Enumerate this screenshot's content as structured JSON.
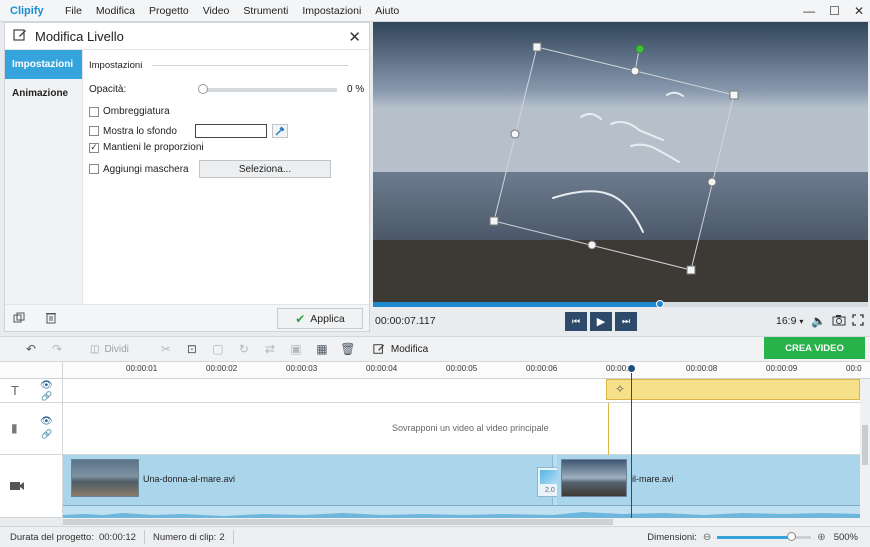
{
  "app": {
    "name": "Clipify"
  },
  "menu": [
    "File",
    "Modifica",
    "Progetto",
    "Video",
    "Strumenti",
    "Impostazioni",
    "Aiuto"
  ],
  "panel": {
    "title": "Modifica Livello",
    "tabs": [
      "Impostazioni",
      "Animazione"
    ],
    "section_title": "Impostazioni",
    "opacity_label": "Opacità:",
    "opacity_value": "0 %",
    "opacity_fraction": 0,
    "shadow_label": "Ombreggiatura",
    "shadow_checked": false,
    "background_label": "Mostra lo sfondo",
    "background_checked": false,
    "proportions_label": "Mantieni le proporzioni",
    "proportions_checked": true,
    "mask_label": "Aggiungi maschera",
    "mask_checked": false,
    "select_button": "Seleziona...",
    "apply_button": "Applica"
  },
  "player": {
    "timecode": "00:00:07.117",
    "aspect": "16:9",
    "progress_fraction": 0.58
  },
  "toolbar": {
    "split_label": "Dividi",
    "edit_label": "Modifica",
    "create_label": "CREA VIDEO"
  },
  "timeline": {
    "ticks": [
      "00:00:01",
      "00:00:02",
      "00:00:03",
      "00:00:04",
      "00:00:05",
      "00:00:06",
      "00:00:0",
      "00:00:08",
      "00:00:09",
      "00:0"
    ],
    "overlay_hint": "Sovrapponi un video al video principale",
    "clip1_name": "Una-donna-al-mare.avi",
    "clip2_name": "il-mare.avi",
    "transition_duration": "2.0"
  },
  "status": {
    "duration_label": "Durata del progetto:",
    "duration_value": "00:00:12",
    "clip_count_label": "Numero di clip:",
    "clip_count_value": "2",
    "dimension_label": "Dimensioni:",
    "zoom_value": "500%",
    "zoom_fraction": 0.78
  },
  "colors": {
    "accent": "#35a4dd",
    "create": "#27b34a",
    "track": "#aad5ea",
    "text_track": "#f7e08a"
  }
}
